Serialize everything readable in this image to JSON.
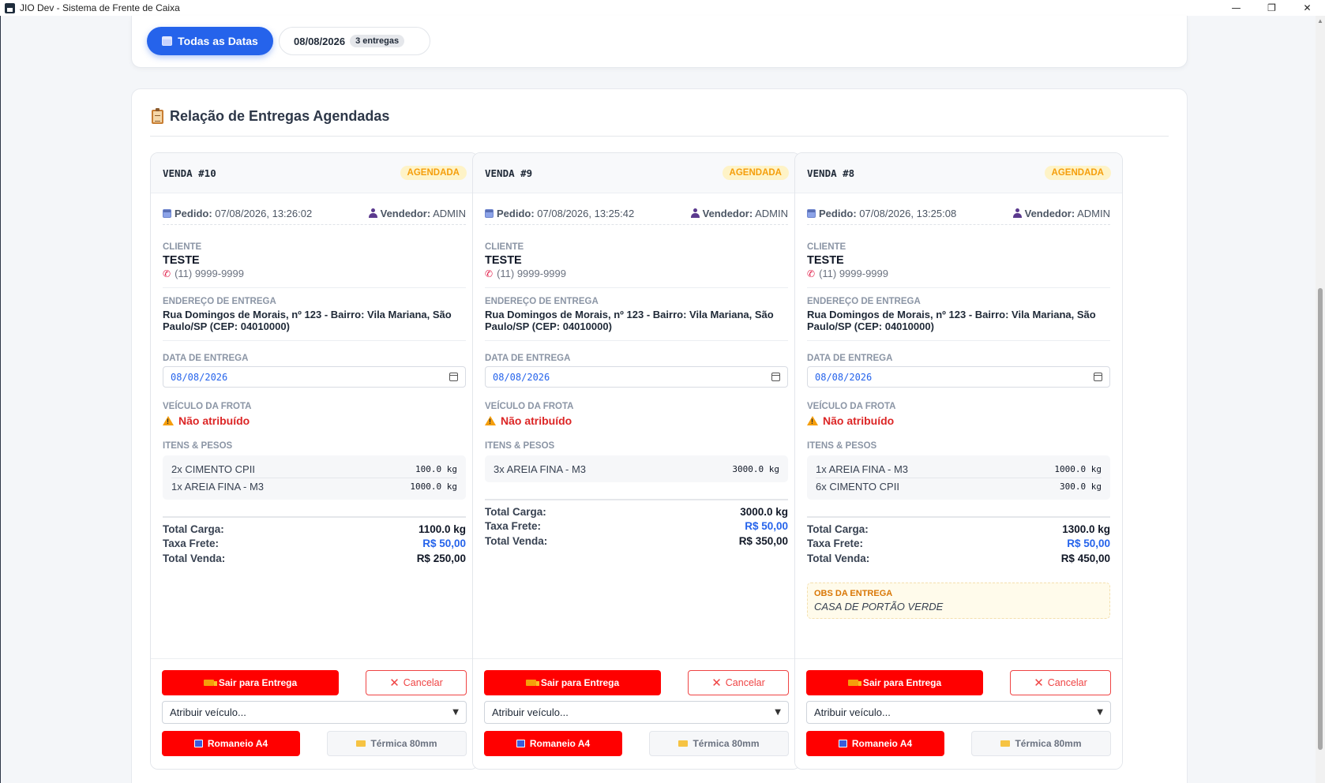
{
  "window": {
    "title": "JIO Dev - Sistema de Frente de Caixa",
    "minimize": "—",
    "restore": "❐",
    "close": "✕"
  },
  "filters": {
    "all_dates_label": "Todas as Datas",
    "date_label": "08/08/2026",
    "date_count": "3 entregas"
  },
  "section": {
    "title": "Relação de Entregas Agendadas"
  },
  "labels": {
    "pedido": "Pedido:",
    "vendedor": "Vendedor:",
    "cliente": "CLIENTE",
    "endereco": "ENDEREÇO DE ENTREGA",
    "data_entrega": "DATA DE ENTREGA",
    "veiculo": "VEÍCULO DA FROTA",
    "itens": "ITENS & PESOS",
    "total_carga": "Total Carga:",
    "taxa_frete": "Taxa Frete:",
    "total_venda": "Total Venda:",
    "obs": "OBS DA ENTREGA",
    "sair": "Sair para Entrega",
    "cancelar": "Cancelar",
    "atribuir": "Atribuir veículo...",
    "romaneio": "Romaneio A4",
    "termica": "Térmica 80mm"
  },
  "cards": [
    {
      "title": "VENDA #10",
      "status": "AGENDADA",
      "pedido_date": "07/08/2026, 13:26:02",
      "vendedor": "ADMIN",
      "cliente": "TESTE",
      "phone": "(11) 9999-9999",
      "address": "Rua Domingos de Morais, nº 123 - Bairro: Vila Mariana, São Paulo/SP (CEP: 04010000)",
      "delivery_date": "08/08/2026",
      "vehicle_status": "Não atribuído",
      "items": [
        {
          "name": "2x CIMENTO CPII",
          "weight": "100.0 kg"
        },
        {
          "name": "1x AREIA FINA - M3",
          "weight": "1000.0 kg"
        }
      ],
      "total_carga": "1100.0 kg",
      "taxa_frete": "R$ 50,00",
      "total_venda": "R$ 250,00",
      "obs": ""
    },
    {
      "title": "VENDA #9",
      "status": "AGENDADA",
      "pedido_date": "07/08/2026, 13:25:42",
      "vendedor": "ADMIN",
      "cliente": "TESTE",
      "phone": "(11) 9999-9999",
      "address": "Rua Domingos de Morais, nº 123 - Bairro: Vila Mariana, São Paulo/SP (CEP: 04010000)",
      "delivery_date": "08/08/2026",
      "vehicle_status": "Não atribuído",
      "items": [
        {
          "name": "3x AREIA FINA - M3",
          "weight": "3000.0 kg"
        }
      ],
      "total_carga": "3000.0 kg",
      "taxa_frete": "R$ 50,00",
      "total_venda": "R$ 350,00",
      "obs": ""
    },
    {
      "title": "VENDA #8",
      "status": "AGENDADA",
      "pedido_date": "07/08/2026, 13:25:08",
      "vendedor": "ADMIN",
      "cliente": "TESTE",
      "phone": "(11) 9999-9999",
      "address": "Rua Domingos de Morais, nº 123 - Bairro: Vila Mariana, São Paulo/SP (CEP: 04010000)",
      "delivery_date": "08/08/2026",
      "vehicle_status": "Não atribuído",
      "items": [
        {
          "name": "1x AREIA FINA - M3",
          "weight": "1000.0 kg"
        },
        {
          "name": "6x CIMENTO CPII",
          "weight": "300.0 kg"
        }
      ],
      "total_carga": "1300.0 kg",
      "taxa_frete": "R$ 50,00",
      "total_venda": "R$ 450,00",
      "obs": "CASA DE PORTÃO VERDE"
    }
  ],
  "colors": {
    "accent": "#2563eb",
    "danger": "#ff0000",
    "status": "#f59e0b"
  }
}
